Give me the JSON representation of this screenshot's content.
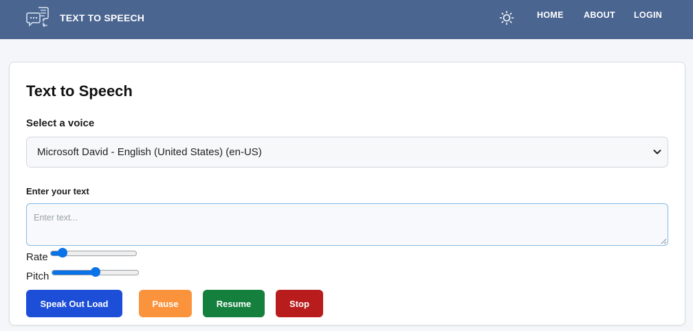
{
  "app": {
    "brand_title": "TEXT TO SPEECH",
    "brand_icon": "speech-bubbles-icon",
    "theme_icon": "sun-icon",
    "bar_color": "#4a6590"
  },
  "nav": {
    "home": "HOME",
    "about": "ABOUT",
    "login": "LOGIN"
  },
  "main": {
    "title": "Text to Speech",
    "voice_label": "Select a voice",
    "voice_value": "Microsoft David - English (United States) (en-US)",
    "text_label": "Enter your text",
    "text_value": "",
    "text_placeholder": "Enter text...",
    "rate_label": "Rate",
    "rate_fraction": 0.1,
    "pitch_label": "Pitch",
    "pitch_fraction": 0.5
  },
  "buttons": {
    "speak": {
      "label": "Speak Out Load",
      "color": "#1d4ed8"
    },
    "pause": {
      "label": "Pause",
      "color": "#fb923c"
    },
    "resume": {
      "label": "Resume",
      "color": "#15803d"
    },
    "stop": {
      "label": "Stop",
      "color": "#b91c1c"
    }
  }
}
